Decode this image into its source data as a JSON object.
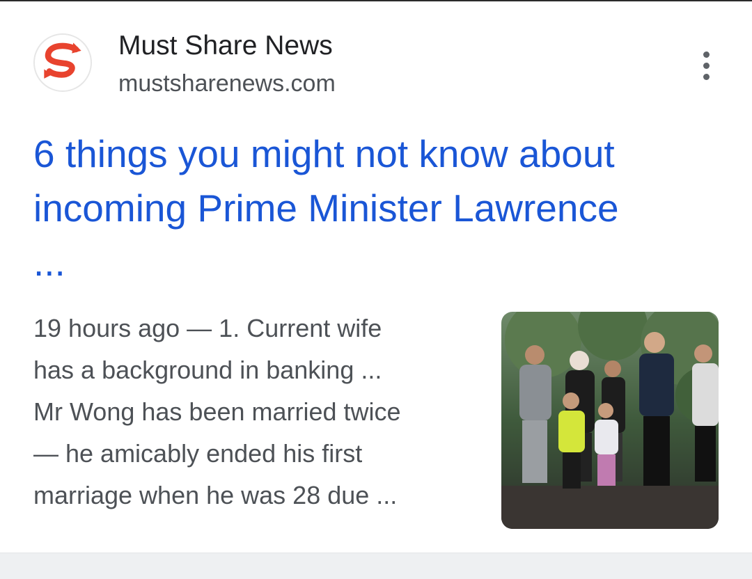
{
  "result": {
    "source_name": "Must Share News",
    "source_url": "mustsharenews.com",
    "logo_icon": "mustsharenews-logo-icon",
    "menu_icon": "more-vert-icon",
    "title_lines": [
      "6 things you might not know about",
      "incoming Prime Minister Lawrence",
      "..."
    ],
    "snippet_lines": [
      "19 hours ago — 1. Current wife",
      "has a background in banking ...",
      "Mr Wong has been married twice",
      "— he amicably ended his first",
      "marriage when he was 28 due ..."
    ],
    "thumbnail": "family-group-photo"
  },
  "colors": {
    "title": "#1a56d6",
    "source": "#202124",
    "snippet": "#4d5156",
    "logo_red": "#e8432e"
  }
}
